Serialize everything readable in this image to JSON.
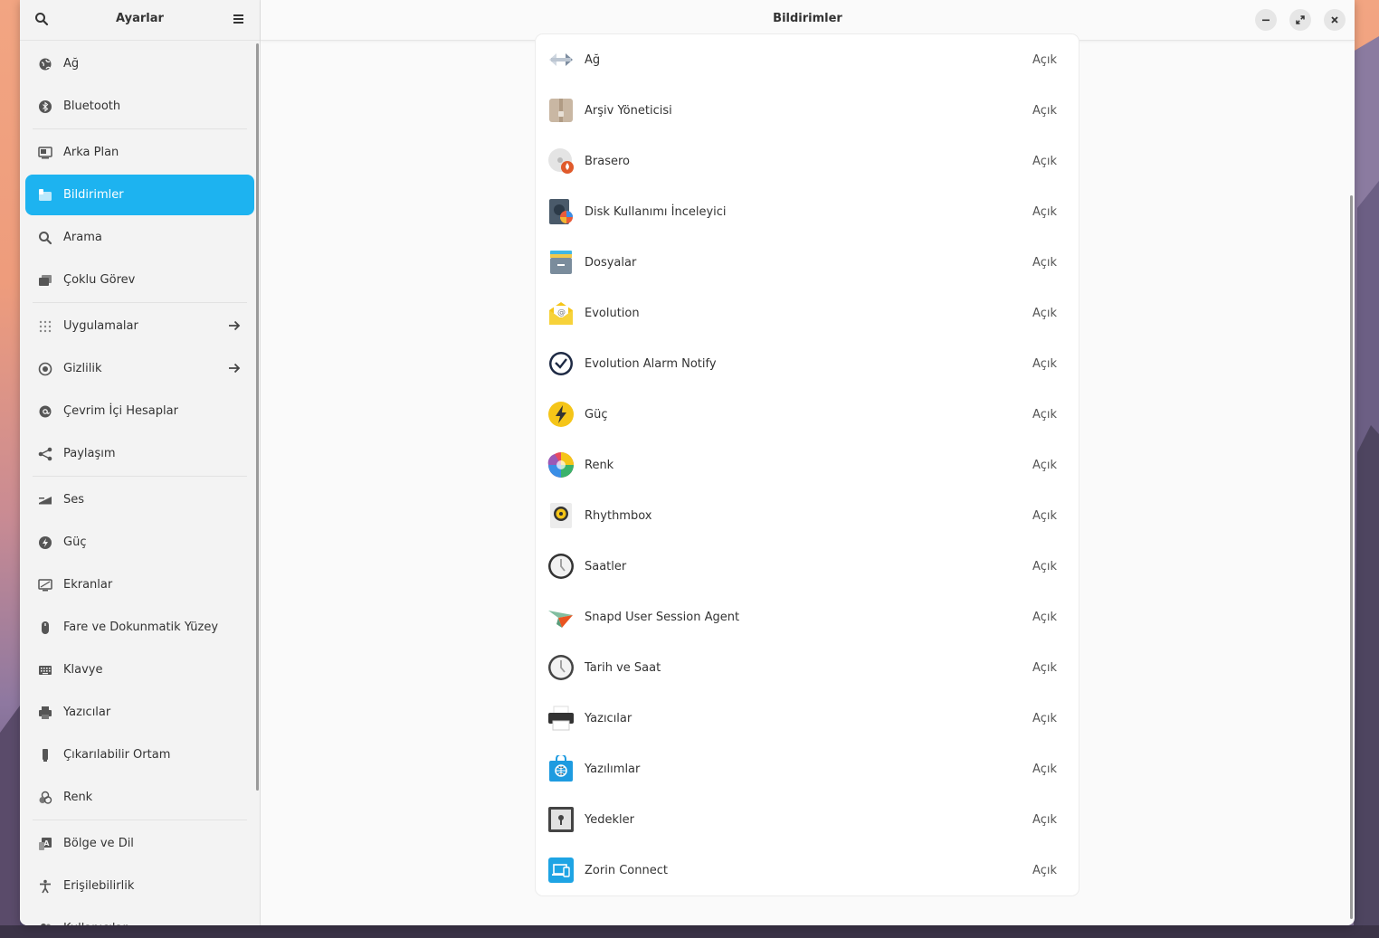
{
  "sidebar": {
    "title": "Ayarlar",
    "items": [
      {
        "label": "Ağ",
        "icon": "network-icon"
      },
      {
        "label": "Bluetooth",
        "icon": "bluetooth-icon"
      },
      {
        "label": "Arka Plan",
        "icon": "background-icon"
      },
      {
        "label": "Bildirimler",
        "icon": "notifications-icon",
        "active": true
      },
      {
        "label": "Arama",
        "icon": "search-icon"
      },
      {
        "label": "Çoklu Görev",
        "icon": "multitasking-icon"
      },
      {
        "label": "Uygulamalar",
        "icon": "apps-grid-icon",
        "arrow": true
      },
      {
        "label": "Gizlilik",
        "icon": "privacy-icon",
        "arrow": true
      },
      {
        "label": "Çevrim İçi Hesaplar",
        "icon": "at-icon"
      },
      {
        "label": "Paylaşım",
        "icon": "share-icon"
      },
      {
        "label": "Ses",
        "icon": "sound-icon"
      },
      {
        "label": "Güç",
        "icon": "power-icon"
      },
      {
        "label": "Ekranlar",
        "icon": "display-icon"
      },
      {
        "label": "Fare ve Dokunmatik Yüzey",
        "icon": "mouse-icon"
      },
      {
        "label": "Klavye",
        "icon": "keyboard-icon"
      },
      {
        "label": "Yazıcılar",
        "icon": "printer-icon"
      },
      {
        "label": "Çıkarılabilir Ortam",
        "icon": "removable-media-icon"
      },
      {
        "label": "Renk",
        "icon": "color-icon"
      },
      {
        "label": "Bölge ve Dil",
        "icon": "region-language-icon"
      },
      {
        "label": "Erişilebilirlik",
        "icon": "accessibility-icon"
      },
      {
        "label": "Kullanıcılar",
        "icon": "users-icon"
      }
    ]
  },
  "main": {
    "title": "Bildirimler",
    "apps": [
      {
        "name": "Ağ",
        "status": "Açık",
        "icon": "network-arrows-icon"
      },
      {
        "name": "Arşiv Yöneticisi",
        "status": "Açık",
        "icon": "archive-manager-icon"
      },
      {
        "name": "Brasero",
        "status": "Açık",
        "icon": "brasero-icon"
      },
      {
        "name": "Disk Kullanımı İnceleyici",
        "status": "Açık",
        "icon": "disk-usage-icon"
      },
      {
        "name": "Dosyalar",
        "status": "Açık",
        "icon": "files-icon"
      },
      {
        "name": "Evolution",
        "status": "Açık",
        "icon": "evolution-icon"
      },
      {
        "name": "Evolution Alarm Notify",
        "status": "Açık",
        "icon": "alarm-clock-icon"
      },
      {
        "name": "Güç",
        "status": "Açık",
        "icon": "power-bolt-icon"
      },
      {
        "name": "Renk",
        "status": "Açık",
        "icon": "color-wheel-icon"
      },
      {
        "name": "Rhythmbox",
        "status": "Açık",
        "icon": "rhythmbox-icon"
      },
      {
        "name": "Saatler",
        "status": "Açık",
        "icon": "clocks-icon"
      },
      {
        "name": "Snapd User Session Agent",
        "status": "Açık",
        "icon": "snapd-icon"
      },
      {
        "name": "Tarih ve Saat",
        "status": "Açık",
        "icon": "date-time-icon"
      },
      {
        "name": "Yazıcılar",
        "status": "Açık",
        "icon": "printers-icon"
      },
      {
        "name": "Yazılımlar",
        "status": "Açık",
        "icon": "software-icon"
      },
      {
        "name": "Yedekler",
        "status": "Açık",
        "icon": "backups-icon"
      },
      {
        "name": "Zorin Connect",
        "status": "Açık",
        "icon": "zorin-connect-icon"
      }
    ]
  }
}
